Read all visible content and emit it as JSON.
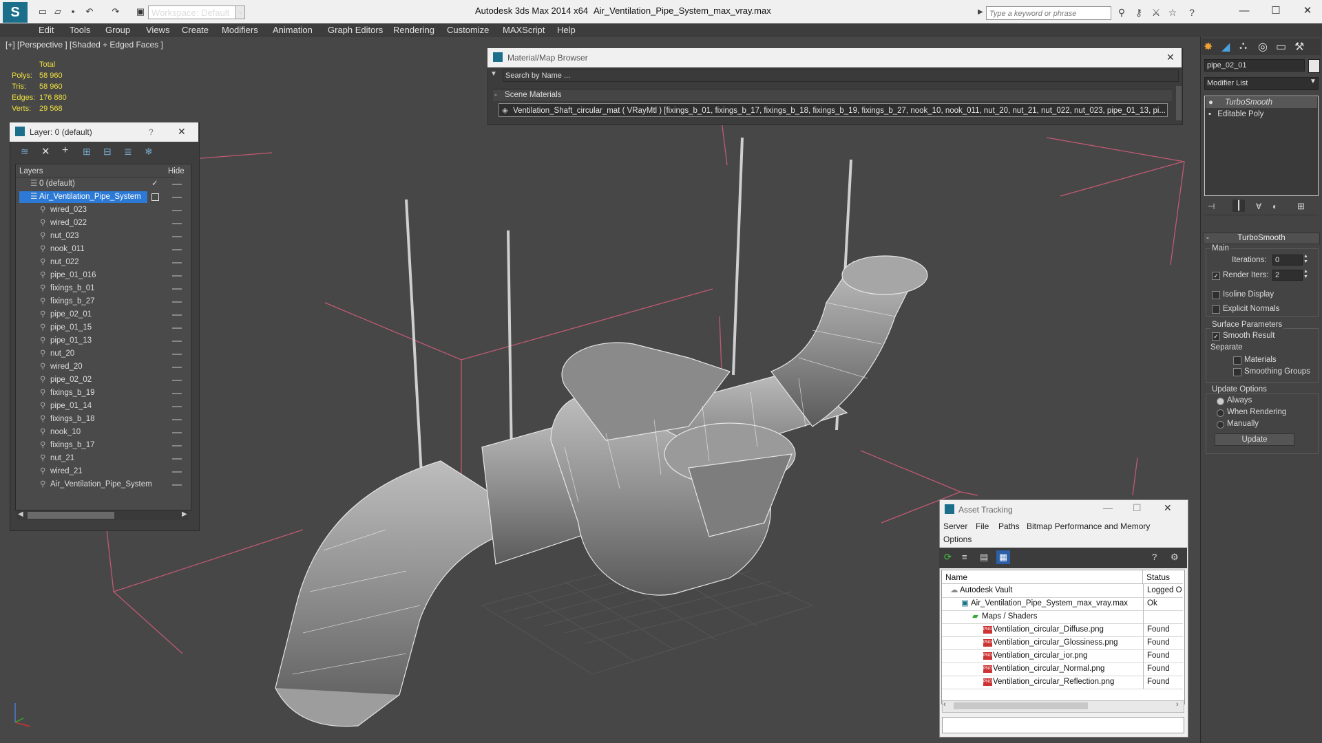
{
  "titlebar": {
    "workspace": "Workspace: Default",
    "app": "Autodesk 3ds Max  2014 x64",
    "file": "Air_Ventilation_Pipe_System_max_vray.max",
    "search_placeholder": "Type a keyword or phrase"
  },
  "menu": [
    "Edit",
    "Tools",
    "Group",
    "Views",
    "Create",
    "Modifiers",
    "Animation",
    "Graph Editors",
    "Rendering",
    "Customize",
    "MAXScript",
    "Help"
  ],
  "viewport": {
    "label": "[+] [Perspective ] [Shaded + Edged Faces ]",
    "stats": {
      "header": "Total",
      "rows": [
        {
          "label": "Polys:",
          "value": "58 960"
        },
        {
          "label": "Tris:",
          "value": "58 960"
        },
        {
          "label": "Edges:",
          "value": "176 880"
        },
        {
          "label": "Verts:",
          "value": "29 568"
        }
      ]
    }
  },
  "layer_panel": {
    "title": "Layer: 0 (default)",
    "help": "?",
    "col_layers": "Layers",
    "col_hide": "Hide",
    "default_layer": "0 (default)",
    "selected_layer": "Air_Ventilation_Pipe_System",
    "items": [
      "wired_023",
      "wired_022",
      "nut_023",
      "nook_011",
      "nut_022",
      "pipe_01_016",
      "fixings_b_01",
      "fixings_b_27",
      "pipe_02_01",
      "pipe_01_15",
      "pipe_01_13",
      "nut_20",
      "wired_20",
      "pipe_02_02",
      "fixings_b_19",
      "pipe_01_14",
      "fixings_b_18",
      "nook_10",
      "fixings_b_17",
      "nut_21",
      "wired_21",
      "Air_Ventilation_Pipe_System"
    ]
  },
  "material_browser": {
    "title": "Material/Map Browser",
    "search_placeholder": "Search by Name ...",
    "section": "Scene Materials",
    "entry": "Ventilation_Shaft_circular_mat  ( VRayMtl )  [fixings_b_01, fixings_b_17, fixings_b_18, fixings_b_19, fixings_b_27, nook_10, nook_011, nut_20, nut_21, nut_022, nut_023, pipe_01_13, pi..."
  },
  "command_panel": {
    "object_name": "pipe_02_01",
    "modifier_list": "Modifier List",
    "stack": [
      "TurboSmooth",
      "Editable Poly"
    ],
    "rollout": "TurboSmooth",
    "main_group": "Main",
    "iterations_label": "Iterations:",
    "iterations_value": "0",
    "render_iters_label": "Render Iters:",
    "render_iters_value": "2",
    "isoline": "Isoline Display",
    "explicit_normals": "Explicit Normals",
    "surface_params": "Surface Parameters",
    "smooth_result": "Smooth Result",
    "separate": "Separate",
    "materials": "Materials",
    "smoothing_groups": "Smoothing Groups",
    "update_options": "Update Options",
    "always": "Always",
    "when_rendering": "When Rendering",
    "manually": "Manually",
    "update_button": "Update"
  },
  "asset_tracking": {
    "title": "Asset Tracking",
    "menu": [
      "Server",
      "File",
      "Paths",
      "Bitmap Performance and Memory",
      "Options"
    ],
    "col_name": "Name",
    "col_status": "Status",
    "rows": [
      {
        "name": "Autodesk Vault",
        "status": "Logged O"
      },
      {
        "name": "Air_Ventilation_Pipe_System_max_vray.max",
        "status": "Ok"
      },
      {
        "name": "Maps / Shaders",
        "status": ""
      },
      {
        "name": "Ventilation_circular_Diffuse.png",
        "status": "Found"
      },
      {
        "name": "Ventilation_circular_Glossiness.png",
        "status": "Found"
      },
      {
        "name": "Ventilation_circular_ior.png",
        "status": "Found"
      },
      {
        "name": "Ventilation_circular_Normal.png",
        "status": "Found"
      },
      {
        "name": "Ventilation_circular_Reflection.png",
        "status": "Found"
      }
    ]
  }
}
